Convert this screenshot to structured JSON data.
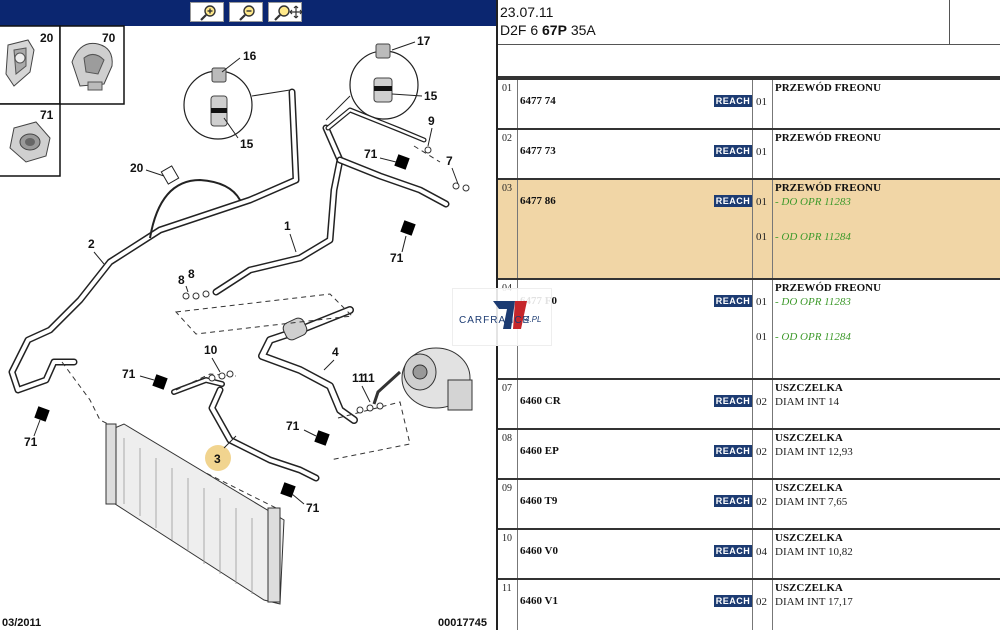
{
  "toolbar": {
    "buttons": [
      {
        "name": "zoom-in",
        "icon": "zoom-in-icon"
      },
      {
        "name": "zoom-out",
        "icon": "zoom-out-icon"
      },
      {
        "name": "zoom-pan",
        "icon": "zoom-pan-icon"
      }
    ]
  },
  "diagram": {
    "labels": {
      "l20": "20",
      "l70": "70",
      "l71a": "71",
      "l16": "16",
      "l15a": "15",
      "l17": "17",
      "l15b": "15",
      "l9": "9",
      "l7": "7",
      "l71b": "71",
      "l71c": "71",
      "l20b": "20",
      "l2": "2",
      "l1": "1",
      "l8a": "8",
      "l8b": "8",
      "l10": "10",
      "l4": "4",
      "l71d": "71",
      "l11a": "11",
      "l11b": "11",
      "l71e": "71",
      "l3": "3",
      "l71f": "71",
      "l71g": "71"
    },
    "footer_left": "03/2011",
    "footer_right": "00017745"
  },
  "watermark": {
    "text": "CARFRANCE",
    "suffix": "4.PL"
  },
  "header": {
    "date": "23.07.11",
    "code_a": "D2F 6 ",
    "code_b": "67P",
    "code_c": " 35A"
  },
  "rows": [
    {
      "idx": "01",
      "ref": "6477 74",
      "badge": "REACH",
      "lines": [
        {
          "qty": "01"
        }
      ],
      "title": "PRZEWÓD FREONU",
      "subs": [],
      "green": []
    },
    {
      "idx": "02",
      "ref": "6477 73",
      "badge": "REACH",
      "lines": [
        {
          "qty": "01"
        }
      ],
      "title": "PRZEWÓD FREONU",
      "subs": [],
      "green": []
    },
    {
      "idx": "03",
      "ref": "6477 86",
      "badge": "REACH",
      "lines": [
        {
          "qty": "01"
        },
        {
          "qty": "01"
        }
      ],
      "title": "PRZEWÓD FREONU",
      "subs": [],
      "green": [
        "- DO OPR 11283",
        "- OD OPR 11284"
      ],
      "highlight": true
    },
    {
      "idx": "04",
      "ref": "6477 F0",
      "badge": "REACH",
      "lines": [
        {
          "qty": "01"
        },
        {
          "qty": "01"
        }
      ],
      "title": "PRZEWÓD FREONU",
      "subs": [],
      "green": [
        "- DO OPR 11283",
        "- OD OPR 11284"
      ]
    },
    {
      "idx": "07",
      "ref": "6460 CR",
      "badge": "REACH",
      "lines": [
        {
          "qty": "02"
        }
      ],
      "title": "USZCZELKA",
      "subs": [
        "DIAM INT 14"
      ],
      "green": []
    },
    {
      "idx": "08",
      "ref": "6460 EP",
      "badge": "REACH",
      "lines": [
        {
          "qty": "02"
        }
      ],
      "title": "USZCZELKA",
      "subs": [
        "DIAM INT 12,93"
      ],
      "green": []
    },
    {
      "idx": "09",
      "ref": "6460 T9",
      "badge": "REACH",
      "lines": [
        {
          "qty": "02"
        }
      ],
      "title": "USZCZELKA",
      "subs": [
        "DIAM INT 7,65"
      ],
      "green": []
    },
    {
      "idx": "10",
      "ref": "6460 V0",
      "badge": "REACH",
      "lines": [
        {
          "qty": "04"
        }
      ],
      "title": "USZCZELKA",
      "subs": [
        "DIAM INT 10,82"
      ],
      "green": []
    },
    {
      "idx": "11",
      "ref": "6460 V1",
      "badge": "REACH",
      "lines": [
        {
          "qty": "02"
        }
      ],
      "title": "USZCZELKA",
      "subs": [
        "DIAM INT 17,17"
      ],
      "green": []
    }
  ]
}
